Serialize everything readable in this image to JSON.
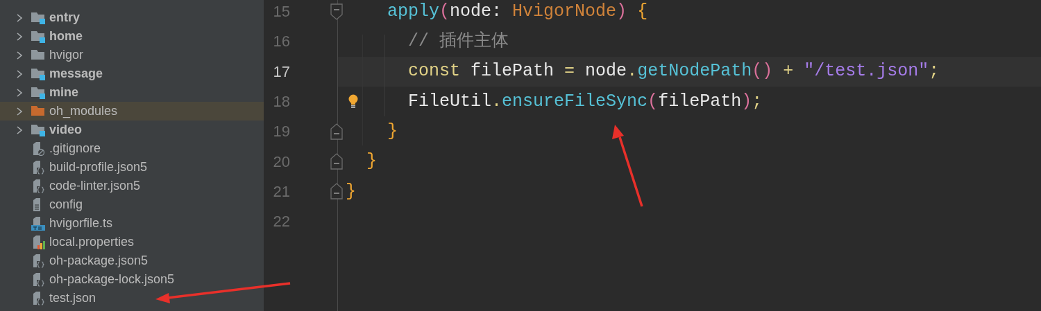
{
  "project_tree": {
    "items": [
      {
        "label": "entry",
        "kind": "module",
        "selected": false
      },
      {
        "label": "home",
        "kind": "module",
        "selected": false
      },
      {
        "label": "hvigor",
        "kind": "folder",
        "selected": false
      },
      {
        "label": "message",
        "kind": "module",
        "selected": false
      },
      {
        "label": "mine",
        "kind": "module",
        "selected": false
      },
      {
        "label": "oh_modules",
        "kind": "excluded",
        "selected": true
      },
      {
        "label": "video",
        "kind": "module",
        "selected": false
      },
      {
        "label": ".gitignore",
        "kind": "ignore",
        "selected": false
      },
      {
        "label": "build-profile.json5",
        "kind": "json",
        "selected": false
      },
      {
        "label": "code-linter.json5",
        "kind": "json",
        "selected": false
      },
      {
        "label": "config",
        "kind": "text",
        "selected": false
      },
      {
        "label": "hvigorfile.ts",
        "kind": "ts",
        "selected": false
      },
      {
        "label": "local.properties",
        "kind": "properties",
        "selected": false
      },
      {
        "label": "oh-package.json5",
        "kind": "json",
        "selected": false
      },
      {
        "label": "oh-package-lock.json5",
        "kind": "json",
        "selected": false
      },
      {
        "label": "test.json",
        "kind": "json",
        "selected": false
      }
    ]
  },
  "editor": {
    "lines": [
      {
        "number": "15",
        "current": false,
        "kind": "fold_start",
        "hint": false,
        "tokens": [
          {
            "kind": "func",
            "text": "    apply"
          },
          {
            "kind": "paren",
            "text": "("
          },
          {
            "kind": "plain",
            "text": "node: "
          },
          {
            "kind": "type",
            "text": "HvigorNode"
          },
          {
            "kind": "paren",
            "text": ")"
          },
          {
            "kind": "brace",
            "text": " {"
          }
        ]
      },
      {
        "number": "16",
        "current": false,
        "kind": "plain",
        "hint": false,
        "tokens": [
          {
            "kind": "comment",
            "text": "      // 插件主体"
          }
        ]
      },
      {
        "number": "17",
        "current": true,
        "kind": "plain",
        "hint": false,
        "tokens": [
          {
            "kind": "keyword",
            "text": "      const"
          },
          {
            "kind": "plain",
            "text": " filePath "
          },
          {
            "kind": "op",
            "text": "="
          },
          {
            "kind": "plain",
            "text": " node"
          },
          {
            "kind": "op",
            "text": "."
          },
          {
            "kind": "func",
            "text": "getNodePath"
          },
          {
            "kind": "paren",
            "text": "()"
          },
          {
            "kind": "op",
            "text": " +"
          },
          {
            "kind": "string",
            "text": " \"/test.json\""
          },
          {
            "kind": "op",
            "text": ";"
          }
        ]
      },
      {
        "number": "18",
        "current": false,
        "kind": "plain",
        "hint": true,
        "tokens": [
          {
            "kind": "plain",
            "text": "      FileUtil"
          },
          {
            "kind": "op",
            "text": "."
          },
          {
            "kind": "func",
            "text": "ensureFileSync"
          },
          {
            "kind": "paren",
            "text": "("
          },
          {
            "kind": "plain",
            "text": "filePath"
          },
          {
            "kind": "paren",
            "text": ")"
          },
          {
            "kind": "op",
            "text": ";"
          }
        ]
      },
      {
        "number": "19",
        "current": false,
        "kind": "fold_end",
        "hint": false,
        "tokens": [
          {
            "kind": "brace",
            "text": "    }"
          }
        ]
      },
      {
        "number": "20",
        "current": false,
        "kind": "fold_end",
        "hint": false,
        "tokens": [
          {
            "kind": "brace",
            "text": "  }"
          }
        ]
      },
      {
        "number": "21",
        "current": false,
        "kind": "fold_end",
        "hint": false,
        "tokens": [
          {
            "kind": "brace",
            "text": "}"
          }
        ]
      },
      {
        "number": "22",
        "current": false,
        "kind": "plain",
        "hint": false
      }
    ]
  }
}
